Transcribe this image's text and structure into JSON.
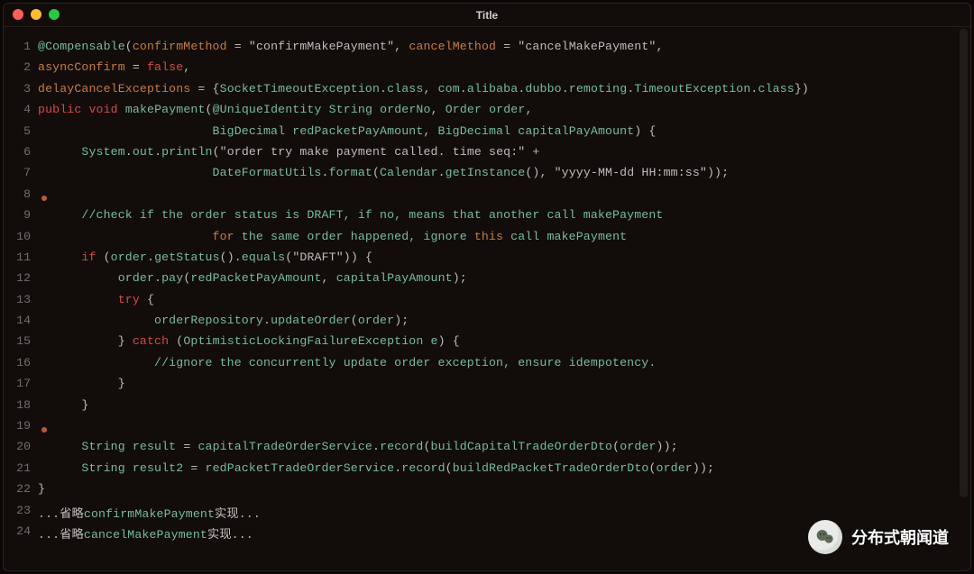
{
  "window": {
    "title": "Title",
    "traffic": {
      "close": "close",
      "minimize": "minimize",
      "maximize": "maximize"
    }
  },
  "watermark": {
    "text": "分布式朝闻道",
    "icon": "wechat-icon"
  },
  "breakpoints": [
    8,
    19
  ],
  "lines": [
    {
      "n": 1,
      "tokens": [
        [
          "ann",
          "@Compensable"
        ],
        [
          "punc",
          "("
        ],
        [
          "attr",
          "confirmMethod"
        ],
        [
          "op",
          " = "
        ],
        [
          "str",
          "\"confirmMakePayment\""
        ],
        [
          "punc",
          ", "
        ],
        [
          "attr",
          "cancelMethod"
        ],
        [
          "op",
          " = "
        ],
        [
          "str",
          "\"cancelMakePayment\""
        ],
        [
          "punc",
          ","
        ]
      ]
    },
    {
      "n": 2,
      "tokens": [
        [
          "attr",
          "asyncConfirm"
        ],
        [
          "op",
          " = "
        ],
        [
          "bool",
          "false"
        ],
        [
          "punc",
          ","
        ]
      ]
    },
    {
      "n": 3,
      "tokens": [
        [
          "attr",
          "delayCancelExceptions"
        ],
        [
          "op",
          " = "
        ],
        [
          "punc",
          "{"
        ],
        [
          "type",
          "SocketTimeoutException"
        ],
        [
          "punc",
          "."
        ],
        [
          "id",
          "class"
        ],
        [
          "punc",
          ", "
        ],
        [
          "id",
          "com"
        ],
        [
          "punc",
          "."
        ],
        [
          "id",
          "alibaba"
        ],
        [
          "punc",
          "."
        ],
        [
          "id",
          "dubbo"
        ],
        [
          "punc",
          "."
        ],
        [
          "id",
          "remoting"
        ],
        [
          "punc",
          "."
        ],
        [
          "type",
          "TimeoutException"
        ],
        [
          "punc",
          "."
        ],
        [
          "id",
          "class"
        ],
        [
          "punc",
          "})"
        ]
      ]
    },
    {
      "n": 4,
      "tokens": [
        [
          "kw",
          "public"
        ],
        [
          "punc",
          " "
        ],
        [
          "kw",
          "void"
        ],
        [
          "punc",
          " "
        ],
        [
          "id",
          "makePayment"
        ],
        [
          "punc",
          "("
        ],
        [
          "ann",
          "@UniqueIdentity"
        ],
        [
          "punc",
          " "
        ],
        [
          "type",
          "String"
        ],
        [
          "punc",
          " "
        ],
        [
          "id",
          "orderNo"
        ],
        [
          "punc",
          ", "
        ],
        [
          "type",
          "Order"
        ],
        [
          "punc",
          " "
        ],
        [
          "id",
          "order"
        ],
        [
          "punc",
          ","
        ]
      ]
    },
    {
      "n": 5,
      "tokens": [
        [
          "punc",
          "                        "
        ],
        [
          "type",
          "BigDecimal"
        ],
        [
          "punc",
          " "
        ],
        [
          "id",
          "redPacketPayAmount"
        ],
        [
          "punc",
          ", "
        ],
        [
          "type",
          "BigDecimal"
        ],
        [
          "punc",
          " "
        ],
        [
          "id",
          "capitalPayAmount"
        ],
        [
          "punc",
          ") {"
        ]
      ]
    },
    {
      "n": 6,
      "tokens": [
        [
          "punc",
          "      "
        ],
        [
          "type",
          "System"
        ],
        [
          "punc",
          "."
        ],
        [
          "id",
          "out"
        ],
        [
          "punc",
          "."
        ],
        [
          "id",
          "println"
        ],
        [
          "punc",
          "("
        ],
        [
          "str",
          "\"order try make payment called. time seq:\""
        ],
        [
          "op",
          " +"
        ]
      ]
    },
    {
      "n": 7,
      "tokens": [
        [
          "punc",
          "                        "
        ],
        [
          "type",
          "DateFormatUtils"
        ],
        [
          "punc",
          "."
        ],
        [
          "id",
          "format"
        ],
        [
          "punc",
          "("
        ],
        [
          "type",
          "Calendar"
        ],
        [
          "punc",
          "."
        ],
        [
          "id",
          "getInstance"
        ],
        [
          "punc",
          "(), "
        ],
        [
          "str",
          "\"yyyy-MM-dd HH:mm:ss\""
        ],
        [
          "punc",
          "));"
        ]
      ]
    },
    {
      "n": 8,
      "tokens": []
    },
    {
      "n": 9,
      "tokens": [
        [
          "punc",
          "      "
        ],
        [
          "cmt",
          "//check if the order status is DRAFT, if no, means that another call makePayment"
        ]
      ]
    },
    {
      "n": 10,
      "tokens": [
        [
          "punc",
          "                        "
        ],
        [
          "attr",
          "for"
        ],
        [
          "cmt",
          " the same order happened, ignore "
        ],
        [
          "attr",
          "this"
        ],
        [
          "cmt",
          " call makePayment"
        ]
      ]
    },
    {
      "n": 11,
      "tokens": [
        [
          "punc",
          "      "
        ],
        [
          "kw",
          "if"
        ],
        [
          "punc",
          " ("
        ],
        [
          "id",
          "order"
        ],
        [
          "punc",
          "."
        ],
        [
          "id",
          "getStatus"
        ],
        [
          "punc",
          "()."
        ],
        [
          "id",
          "equals"
        ],
        [
          "punc",
          "("
        ],
        [
          "str",
          "\"DRAFT\""
        ],
        [
          "punc",
          ")) {"
        ]
      ]
    },
    {
      "n": 12,
      "tokens": [
        [
          "punc",
          "           "
        ],
        [
          "id",
          "order"
        ],
        [
          "punc",
          "."
        ],
        [
          "id",
          "pay"
        ],
        [
          "punc",
          "("
        ],
        [
          "id",
          "redPacketPayAmount"
        ],
        [
          "punc",
          ", "
        ],
        [
          "id",
          "capitalPayAmount"
        ],
        [
          "punc",
          ");"
        ]
      ]
    },
    {
      "n": 13,
      "tokens": [
        [
          "punc",
          "           "
        ],
        [
          "kw",
          "try"
        ],
        [
          "punc",
          " {"
        ]
      ]
    },
    {
      "n": 14,
      "tokens": [
        [
          "punc",
          "                "
        ],
        [
          "id",
          "orderRepository"
        ],
        [
          "punc",
          "."
        ],
        [
          "id",
          "updateOrder"
        ],
        [
          "punc",
          "("
        ],
        [
          "id",
          "order"
        ],
        [
          "punc",
          ");"
        ]
      ]
    },
    {
      "n": 15,
      "tokens": [
        [
          "punc",
          "           } "
        ],
        [
          "kw",
          "catch"
        ],
        [
          "punc",
          " ("
        ],
        [
          "type",
          "OptimisticLockingFailureException"
        ],
        [
          "punc",
          " "
        ],
        [
          "id",
          "e"
        ],
        [
          "punc",
          ") {"
        ]
      ]
    },
    {
      "n": 16,
      "tokens": [
        [
          "punc",
          "                "
        ],
        [
          "cmt",
          "//ignore the concurrently update order exception, ensure idempotency."
        ]
      ]
    },
    {
      "n": 17,
      "tokens": [
        [
          "punc",
          "           }"
        ]
      ]
    },
    {
      "n": 18,
      "tokens": [
        [
          "punc",
          "      }"
        ]
      ]
    },
    {
      "n": 19,
      "tokens": []
    },
    {
      "n": 20,
      "tokens": [
        [
          "punc",
          "      "
        ],
        [
          "type",
          "String"
        ],
        [
          "punc",
          " "
        ],
        [
          "id",
          "result"
        ],
        [
          "op",
          " = "
        ],
        [
          "id",
          "capitalTradeOrderService"
        ],
        [
          "punc",
          "."
        ],
        [
          "id",
          "record"
        ],
        [
          "punc",
          "("
        ],
        [
          "id",
          "buildCapitalTradeOrderDto"
        ],
        [
          "punc",
          "("
        ],
        [
          "id",
          "order"
        ],
        [
          "punc",
          "));"
        ]
      ]
    },
    {
      "n": 21,
      "tokens": [
        [
          "punc",
          "      "
        ],
        [
          "type",
          "String"
        ],
        [
          "punc",
          " "
        ],
        [
          "id",
          "result2"
        ],
        [
          "op",
          " = "
        ],
        [
          "id",
          "redPacketTradeOrderService"
        ],
        [
          "punc",
          "."
        ],
        [
          "id",
          "record"
        ],
        [
          "punc",
          "("
        ],
        [
          "id",
          "buildRedPacketTradeOrderDto"
        ],
        [
          "punc",
          "("
        ],
        [
          "id",
          "order"
        ],
        [
          "punc",
          "));"
        ]
      ]
    },
    {
      "n": 22,
      "tokens": [
        [
          "punc",
          "}"
        ]
      ]
    },
    {
      "n": 23,
      "tokens": [
        [
          "punc",
          "..."
        ],
        [
          "cn",
          "省略"
        ],
        [
          "id",
          "confirmMakePayment"
        ],
        [
          "cn",
          "实现"
        ],
        [
          "punc",
          "..."
        ]
      ]
    },
    {
      "n": 24,
      "tokens": [
        [
          "punc",
          "..."
        ],
        [
          "cn",
          "省略"
        ],
        [
          "id",
          "cancelMakePayment"
        ],
        [
          "cn",
          "实现"
        ],
        [
          "punc",
          "..."
        ]
      ]
    }
  ]
}
